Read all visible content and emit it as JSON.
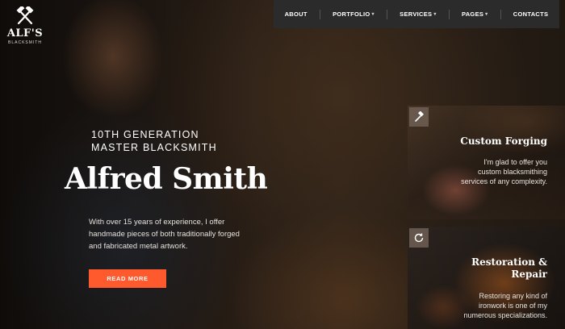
{
  "brand": {
    "name": "ALF'S",
    "tagline": "BLACKSMITH"
  },
  "nav": {
    "items": [
      {
        "label": "ABOUT",
        "dropdown": false
      },
      {
        "label": "PORTFOLIO",
        "dropdown": true
      },
      {
        "label": "SERVICES",
        "dropdown": true
      },
      {
        "label": "PAGES",
        "dropdown": true
      },
      {
        "label": "CONTACTS",
        "dropdown": false
      }
    ]
  },
  "hero": {
    "eyebrow_line1": "10TH GENERATION",
    "eyebrow_line2": "MASTER BLACKSMITH",
    "name": "Alfred Smith",
    "description": "With over 15 years of experience, I offer handmade pieces of both traditionally forged and fabricated metal artwork.",
    "cta_label": "READ MORE"
  },
  "services": [
    {
      "icon": "hammer-icon",
      "title": "Custom Forging",
      "description": "I'm glad to offer you custom blacksmithing services of any complexity."
    },
    {
      "icon": "restore-icon",
      "title": "Restoration & Repair",
      "description": "Restoring any kind of ironwork is one of my numerous specializations."
    }
  ],
  "colors": {
    "accent": "#ff5a2e",
    "nav_bg": "#2b2b2b"
  }
}
